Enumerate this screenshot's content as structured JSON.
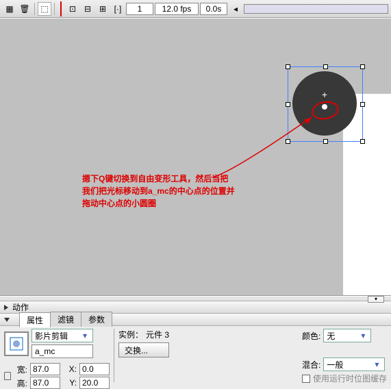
{
  "timeline": {
    "frame": "1",
    "fps": "12.0 fps",
    "time": "0.0s"
  },
  "hint": {
    "line1": "摁下Q键切换到自由变形工具，然后当把",
    "line2": "我们把光标移动到a_mc的中心点的位置并",
    "line3": "拖动中心点的小圆圈"
  },
  "panels": {
    "actions": "动作",
    "tabs": {
      "props": "属性",
      "filters": "滤镜",
      "params": "参数"
    }
  },
  "props": {
    "type": "影片剪辑",
    "name": "a_mc",
    "instance_label": "实例：",
    "instance_value": "元件 3",
    "swap_btn": "交换...",
    "color_label": "颜色:",
    "color_value": "无",
    "blend_label": "混合:",
    "blend_value": "一般",
    "runtime_chk": "使用运行时位图缓存",
    "w_lbl": "宽:",
    "w_val": "87.0",
    "h_lbl": "高:",
    "h_val": "87.0",
    "x_lbl": "X:",
    "x_val": "0.0",
    "y_lbl": "Y:",
    "y_val": "20.0"
  }
}
